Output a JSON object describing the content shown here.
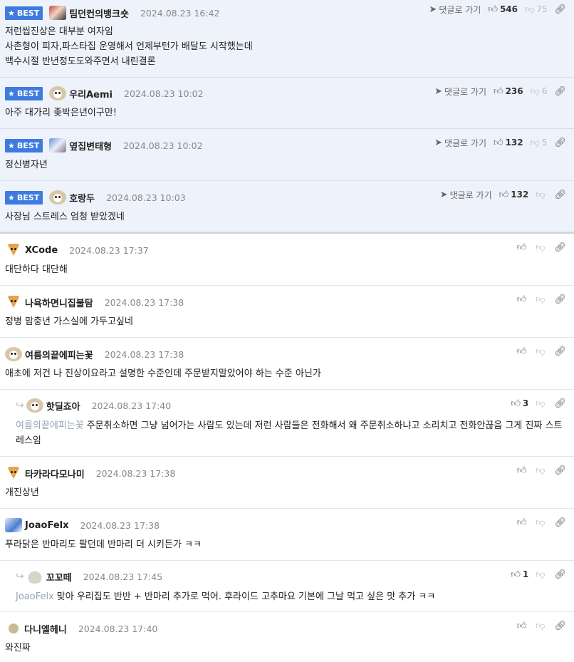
{
  "ui": {
    "best_label": "BEST",
    "goto_reply_label": "댓글로 가기"
  },
  "best_comments": [
    {
      "nick": "팀던컨의뱅크숏",
      "date": "2024.08.23 16:42",
      "likes": "546",
      "dislikes": "75",
      "lines": [
        "저런씹진상은 대부분 여자임",
        "사촌형이 피자,파스타집 운영해서 언제부턴가 배달도 시작했는데",
        "백수시절 반년정도도와주면서 내린결론"
      ]
    },
    {
      "nick": "우리Aemi",
      "date": "2024.08.23 10:02",
      "likes": "236",
      "dislikes": "6",
      "lines": [
        "아주 대가리 좆박은년이구만!"
      ]
    },
    {
      "nick": "옆집변태형",
      "date": "2024.08.23 10:02",
      "likes": "132",
      "dislikes": "5",
      "lines": [
        "정신병자년"
      ]
    },
    {
      "nick": "호랑두",
      "date": "2024.08.23 10:03",
      "likes": "132",
      "dislikes": "",
      "lines": [
        "사장님 스트레스 엄청 받았겠네"
      ]
    }
  ],
  "comments": [
    {
      "nick": "XCode",
      "date": "2024.08.23 17:37",
      "likes": "",
      "text": "대단하다 대단해"
    },
    {
      "nick": "나욕하면니집불탐",
      "date": "2024.08.23 17:38",
      "likes": "",
      "text": "정병 맘충년 가스실에 가두고싶네"
    },
    {
      "nick": "여름의끝에피는꽃",
      "date": "2024.08.23 17:38",
      "likes": "",
      "text": "애초에 저건 나 진상이요라고 설명한 수준인데 주문받지말았어야 하는 수준 아닌가"
    },
    {
      "nick": "핫딜죠아",
      "date": "2024.08.23 17:40",
      "likes": "3",
      "mention": "여름의끝에피는꽃",
      "text": "주문취소하면 그냥 넘어가는 사람도 있는데 저런 사람들은 전화해서 왜 주문취소하냐고 소리치고 전화안끊음 그게 진짜 스트레스임"
    },
    {
      "nick": "타카라다모나미",
      "date": "2024.08.23 17:38",
      "likes": "",
      "text": "개진상년"
    },
    {
      "nick": "JoaoFelx",
      "date": "2024.08.23 17:38",
      "likes": "",
      "text": "푸라닭은 반마리도 팔던데 반마리 더 시키든가 ㅋㅋ"
    },
    {
      "nick": "꼬꼬떼",
      "date": "2024.08.23 17:45",
      "likes": "1",
      "mention": "JoaoFelx",
      "text": "맞아 우리집도 반반 + 반마리 추가로 먹어. 후라이드 고추마요 기본에 그날 먹고 싶은 맛 추가 ㅋㅋ"
    },
    {
      "nick": "다니엘헤니",
      "date": "2024.08.23 17:40",
      "likes": "",
      "text": "와진짜"
    }
  ]
}
